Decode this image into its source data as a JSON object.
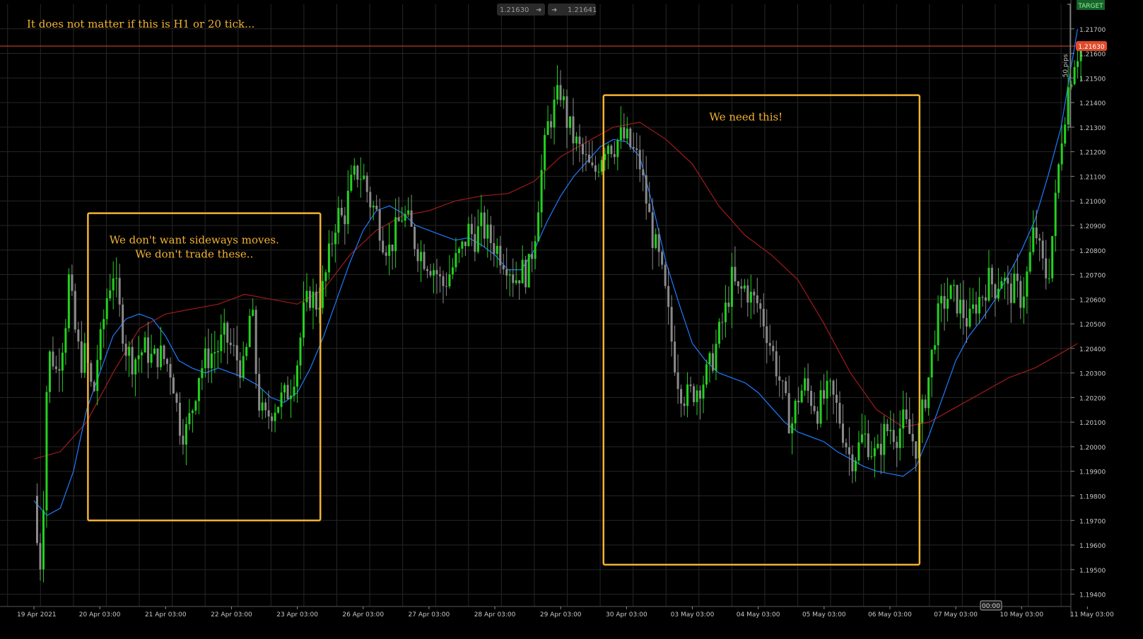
{
  "chart_data": {
    "type": "candlestick",
    "instrument_prices": {
      "bid": "1.2163",
      "ask": "1.2164",
      "bid_suffix": "0",
      "ask_suffix": "1"
    },
    "current_price": 1.2163,
    "current_price_label": "1.21630",
    "target_label": "TARGET",
    "pips_label": "50 pips",
    "pips_range": [
      1.213,
      1.218
    ],
    "time_marker": "00:00",
    "ylim": [
      1.1935,
      1.218
    ],
    "y_ticks": [
      "1.1940",
      "1.1950",
      "1.1960",
      "1.1970",
      "1.1980",
      "1.1990",
      "1.2000",
      "1.2010",
      "1.2020",
      "1.2030",
      "1.2040",
      "1.2050",
      "1.2060",
      "1.2070",
      "1.2080",
      "1.2090",
      "1.2100",
      "1.2110",
      "1.2120",
      "1.2130",
      "1.2140",
      "1.2150",
      "1.2160",
      "1.2170"
    ],
    "x_ticks": [
      "19 Apr 2021",
      "20 Apr 03:00",
      "21 Apr 03:00",
      "22 Apr 03:00",
      "23 Apr 03:00",
      "26 Apr 03:00",
      "27 Apr 03:00",
      "28 Apr 03:00",
      "29 Apr 03:00",
      "30 Apr 03:00",
      "03 May 03:00",
      "04 May 03:00",
      "05 May 03:00",
      "06 May 03:00",
      "07 May 03:00",
      "10 May 03:00",
      "11 May 03:00"
    ],
    "x_tick_offsets": [
      0.0,
      0.0,
      0.0,
      0.0,
      0.0,
      0.0,
      0.0,
      0.0,
      0.0,
      0.0,
      0.0,
      0.0,
      0.0,
      0.0,
      0.0,
      0.0,
      0.0
    ],
    "close_path": [
      [
        0.0,
        1.198
      ],
      [
        0.03,
        1.197
      ],
      [
        0.08,
        1.1945
      ],
      [
        0.14,
        1.1975
      ],
      [
        0.2,
        1.203
      ],
      [
        0.26,
        1.204
      ],
      [
        0.33,
        1.203
      ],
      [
        0.4,
        1.2038
      ],
      [
        0.47,
        1.2048
      ],
      [
        0.53,
        1.2068
      ],
      [
        0.59,
        1.2055
      ],
      [
        0.65,
        1.2042
      ],
      [
        0.72,
        1.2035
      ],
      [
        0.78,
        1.2038
      ],
      [
        0.84,
        1.203
      ],
      [
        0.9,
        1.2018
      ],
      [
        0.95,
        1.2035
      ],
      [
        1.0,
        1.204
      ],
      [
        1.1,
        1.206
      ],
      [
        1.2,
        1.2072
      ],
      [
        1.3,
        1.2055
      ],
      [
        1.4,
        1.204
      ],
      [
        1.5,
        1.2035
      ],
      [
        1.6,
        1.2038
      ],
      [
        1.7,
        1.204
      ],
      [
        1.8,
        1.2035
      ],
      [
        1.9,
        1.2038
      ],
      [
        2.0,
        1.2035
      ],
      [
        2.1,
        1.203
      ],
      [
        2.2,
        1.201
      ],
      [
        2.3,
        1.2005
      ],
      [
        2.4,
        1.2015
      ],
      [
        2.5,
        1.203
      ],
      [
        2.6,
        1.2035
      ],
      [
        2.7,
        1.2038
      ],
      [
        2.8,
        1.204
      ],
      [
        2.9,
        1.2045
      ],
      [
        3.0,
        1.204
      ],
      [
        3.1,
        1.2035
      ],
      [
        3.2,
        1.203
      ],
      [
        3.3,
        1.206
      ],
      [
        3.4,
        1.202
      ],
      [
        3.5,
        1.201
      ],
      [
        3.6,
        1.2015
      ],
      [
        3.7,
        1.2018
      ],
      [
        3.8,
        1.202
      ],
      [
        3.9,
        1.2025
      ],
      [
        4.0,
        1.2035
      ],
      [
        4.1,
        1.2055
      ],
      [
        4.2,
        1.2062
      ],
      [
        4.3,
        1.2058
      ],
      [
        4.4,
        1.2065
      ],
      [
        4.5,
        1.208
      ],
      [
        4.6,
        1.2095
      ],
      [
        4.7,
        1.2092
      ],
      [
        4.8,
        1.2105
      ],
      [
        4.9,
        1.2112
      ],
      [
        5.0,
        1.211
      ],
      [
        5.1,
        1.21
      ],
      [
        5.2,
        1.2095
      ],
      [
        5.3,
        1.2085
      ],
      [
        5.4,
        1.208
      ],
      [
        5.5,
        1.2088
      ],
      [
        5.6,
        1.2095
      ],
      [
        5.7,
        1.209
      ],
      [
        5.8,
        1.2082
      ],
      [
        5.9,
        1.2078
      ],
      [
        6.0,
        1.2075
      ],
      [
        6.1,
        1.2072
      ],
      [
        6.2,
        1.2065
      ],
      [
        6.3,
        1.207
      ],
      [
        6.4,
        1.2075
      ],
      [
        6.5,
        1.208
      ],
      [
        6.6,
        1.2088
      ],
      [
        6.7,
        1.2085
      ],
      [
        6.8,
        1.209
      ],
      [
        6.9,
        1.2085
      ],
      [
        7.0,
        1.2082
      ],
      [
        7.1,
        1.2078
      ],
      [
        7.2,
        1.2075
      ],
      [
        7.3,
        1.2068
      ],
      [
        7.4,
        1.2072
      ],
      [
        7.5,
        1.207
      ],
      [
        7.6,
        1.2085
      ],
      [
        7.7,
        1.211
      ],
      [
        7.8,
        1.213
      ],
      [
        7.9,
        1.2138
      ],
      [
        8.0,
        1.2145
      ],
      [
        8.1,
        1.2132
      ],
      [
        8.2,
        1.2125
      ],
      [
        8.3,
        1.212
      ],
      [
        8.4,
        1.2115
      ],
      [
        8.5,
        1.211
      ],
      [
        8.6,
        1.2118
      ],
      [
        8.7,
        1.2125
      ],
      [
        8.8,
        1.2122
      ],
      [
        8.9,
        1.2126
      ],
      [
        9.0,
        1.2125
      ],
      [
        9.1,
        1.212
      ],
      [
        9.2,
        1.2115
      ],
      [
        9.3,
        1.21
      ],
      [
        9.4,
        1.2085
      ],
      [
        9.5,
        1.2075
      ],
      [
        9.6,
        1.206
      ],
      [
        9.7,
        1.204
      ],
      [
        9.8,
        1.2025
      ],
      [
        9.9,
        1.202
      ],
      [
        10.0,
        1.2022
      ],
      [
        10.1,
        1.2025
      ],
      [
        10.2,
        1.2028
      ],
      [
        10.3,
        1.2035
      ],
      [
        10.4,
        1.2045
      ],
      [
        10.5,
        1.2055
      ],
      [
        10.6,
        1.2068
      ],
      [
        10.7,
        1.2062
      ],
      [
        10.8,
        1.2065
      ],
      [
        10.9,
        1.206
      ],
      [
        11.0,
        1.2058
      ],
      [
        11.1,
        1.205
      ],
      [
        11.2,
        1.204
      ],
      [
        11.3,
        1.203
      ],
      [
        11.4,
        1.2018
      ],
      [
        11.5,
        1.2008
      ],
      [
        11.6,
        1.202
      ],
      [
        11.7,
        1.2025
      ],
      [
        11.8,
        1.202
      ],
      [
        11.9,
        1.2015
      ],
      [
        12.0,
        1.202
      ],
      [
        12.1,
        1.2022
      ],
      [
        12.2,
        1.2015
      ],
      [
        12.3,
        1.2005
      ],
      [
        12.4,
        1.1995
      ],
      [
        12.5,
        1.1998
      ],
      [
        12.6,
        1.2005
      ],
      [
        12.7,
        1.2
      ],
      [
        12.8,
        1.1995
      ],
      [
        12.9,
        1.2005
      ],
      [
        13.0,
        1.2008
      ],
      [
        13.1,
        1.2005
      ],
      [
        13.2,
        1.201
      ],
      [
        13.3,
        1.2005
      ],
      [
        13.4,
        1.2
      ],
      [
        13.5,
        1.2015
      ],
      [
        13.6,
        1.203
      ],
      [
        13.7,
        1.205
      ],
      [
        13.8,
        1.2058
      ],
      [
        13.9,
        1.2062
      ],
      [
        14.0,
        1.206
      ],
      [
        14.1,
        1.2055
      ],
      [
        14.2,
        1.205
      ],
      [
        14.3,
        1.2058
      ],
      [
        14.4,
        1.2062
      ],
      [
        14.5,
        1.2068
      ],
      [
        14.6,
        1.2065
      ],
      [
        14.7,
        1.207
      ],
      [
        14.8,
        1.2062
      ],
      [
        14.9,
        1.2065
      ],
      [
        15.0,
        1.206
      ],
      [
        15.1,
        1.2072
      ],
      [
        15.2,
        1.209
      ],
      [
        15.3,
        1.2075
      ],
      [
        15.4,
        1.2068
      ],
      [
        15.5,
        1.2095
      ],
      [
        15.6,
        1.2125
      ],
      [
        15.7,
        1.2145
      ],
      [
        15.8,
        1.2158
      ],
      [
        15.9,
        1.2163
      ]
    ],
    "ma_fast": [
      [
        0.0,
        1.1978
      ],
      [
        0.2,
        1.1972
      ],
      [
        0.4,
        1.1975
      ],
      [
        0.6,
        1.199
      ],
      [
        0.8,
        1.2015
      ],
      [
        1.0,
        1.203
      ],
      [
        1.2,
        1.2045
      ],
      [
        1.4,
        1.2052
      ],
      [
        1.6,
        1.2054
      ],
      [
        1.8,
        1.2052
      ],
      [
        2.0,
        1.2045
      ],
      [
        2.2,
        1.2035
      ],
      [
        2.4,
        1.2032
      ],
      [
        2.6,
        1.203
      ],
      [
        2.8,
        1.2032
      ],
      [
        3.0,
        1.203
      ],
      [
        3.2,
        1.2028
      ],
      [
        3.4,
        1.2025
      ],
      [
        3.6,
        1.202
      ],
      [
        3.8,
        1.2018
      ],
      [
        4.0,
        1.2022
      ],
      [
        4.2,
        1.2032
      ],
      [
        4.4,
        1.2045
      ],
      [
        4.6,
        1.206
      ],
      [
        4.8,
        1.2075
      ],
      [
        5.0,
        1.2088
      ],
      [
        5.2,
        1.2096
      ],
      [
        5.4,
        1.2098
      ],
      [
        5.6,
        1.2095
      ],
      [
        5.8,
        1.209
      ],
      [
        6.0,
        1.2088
      ],
      [
        6.2,
        1.2086
      ],
      [
        6.4,
        1.2084
      ],
      [
        6.6,
        1.2085
      ],
      [
        6.8,
        1.2082
      ],
      [
        7.0,
        1.2078
      ],
      [
        7.2,
        1.2072
      ],
      [
        7.4,
        1.2072
      ],
      [
        7.6,
        1.208
      ],
      [
        7.8,
        1.2092
      ],
      [
        8.0,
        1.2102
      ],
      [
        8.2,
        1.211
      ],
      [
        8.4,
        1.2116
      ],
      [
        8.6,
        1.2122
      ],
      [
        8.8,
        1.2125
      ],
      [
        9.0,
        1.2124
      ],
      [
        9.2,
        1.2118
      ],
      [
        9.4,
        1.2098
      ],
      [
        9.6,
        1.2075
      ],
      [
        9.8,
        1.2058
      ],
      [
        10.0,
        1.2042
      ],
      [
        10.2,
        1.2035
      ],
      [
        10.4,
        1.203
      ],
      [
        10.6,
        1.2028
      ],
      [
        10.8,
        1.2026
      ],
      [
        11.0,
        1.2022
      ],
      [
        11.2,
        1.2016
      ],
      [
        11.4,
        1.201
      ],
      [
        11.6,
        1.2006
      ],
      [
        11.8,
        1.2004
      ],
      [
        12.0,
        1.2002
      ],
      [
        12.2,
        1.1998
      ],
      [
        12.4,
        1.1995
      ],
      [
        12.6,
        1.1992
      ],
      [
        12.8,
        1.199
      ],
      [
        13.0,
        1.1989
      ],
      [
        13.2,
        1.1988
      ],
      [
        13.4,
        1.1992
      ],
      [
        13.6,
        1.2005
      ],
      [
        13.8,
        1.202
      ],
      [
        14.0,
        1.2035
      ],
      [
        14.2,
        1.2045
      ],
      [
        14.4,
        1.2052
      ],
      [
        14.6,
        1.206
      ],
      [
        14.8,
        1.207
      ],
      [
        15.0,
        1.208
      ],
      [
        15.2,
        1.2092
      ],
      [
        15.4,
        1.211
      ],
      [
        15.6,
        1.213
      ],
      [
        15.85,
        1.217
      ]
    ],
    "ma_slow": [
      [
        0.0,
        1.1995
      ],
      [
        0.4,
        1.1998
      ],
      [
        0.8,
        1.201
      ],
      [
        1.2,
        1.203
      ],
      [
        1.6,
        1.2048
      ],
      [
        2.0,
        1.2054
      ],
      [
        2.4,
        1.2056
      ],
      [
        2.8,
        1.2058
      ],
      [
        3.2,
        1.2062
      ],
      [
        3.6,
        1.206
      ],
      [
        4.0,
        1.2058
      ],
      [
        4.4,
        1.2064
      ],
      [
        4.8,
        1.2078
      ],
      [
        5.2,
        1.2088
      ],
      [
        5.6,
        1.2094
      ],
      [
        6.0,
        1.2096
      ],
      [
        6.4,
        1.21
      ],
      [
        6.8,
        1.2102
      ],
      [
        7.2,
        1.2103
      ],
      [
        7.6,
        1.2108
      ],
      [
        8.0,
        1.2118
      ],
      [
        8.4,
        1.2124
      ],
      [
        8.8,
        1.213
      ],
      [
        9.2,
        1.2132
      ],
      [
        9.6,
        1.2125
      ],
      [
        10.0,
        1.2115
      ],
      [
        10.4,
        1.2098
      ],
      [
        10.8,
        1.2086
      ],
      [
        11.2,
        1.2078
      ],
      [
        11.6,
        1.2068
      ],
      [
        12.0,
        1.205
      ],
      [
        12.4,
        1.203
      ],
      [
        12.8,
        1.2015
      ],
      [
        13.2,
        1.2008
      ],
      [
        13.6,
        1.201
      ],
      [
        14.0,
        1.2016
      ],
      [
        14.4,
        1.2022
      ],
      [
        14.8,
        1.2028
      ],
      [
        15.2,
        1.2032
      ],
      [
        15.6,
        1.2038
      ],
      [
        15.85,
        1.2042
      ]
    ],
    "annotations": [
      {
        "text": "It does not matter if this is H1 or 20 tick...",
        "kind": "header"
      },
      {
        "text_lines": [
          "We don't want sideways moves.",
          "We don't trade these.."
        ],
        "kind": "box",
        "x_range": [
          0.82,
          4.35
        ],
        "y_range": [
          1.197,
          1.2095
        ]
      },
      {
        "text_lines": [
          "We need this!"
        ],
        "kind": "box",
        "x_range": [
          8.65,
          13.45
        ],
        "y_range": [
          1.1952,
          1.2143
        ]
      }
    ],
    "colors": {
      "bull": "#23d11f",
      "bear": "#8a8a8a",
      "ma_fast": "#1e7bff",
      "ma_slow": "#a11b1b",
      "price_line": "#e04a2a",
      "annotation": "#f2b233",
      "grid": "#262626",
      "axis_text": "#c8c8c8"
    }
  }
}
